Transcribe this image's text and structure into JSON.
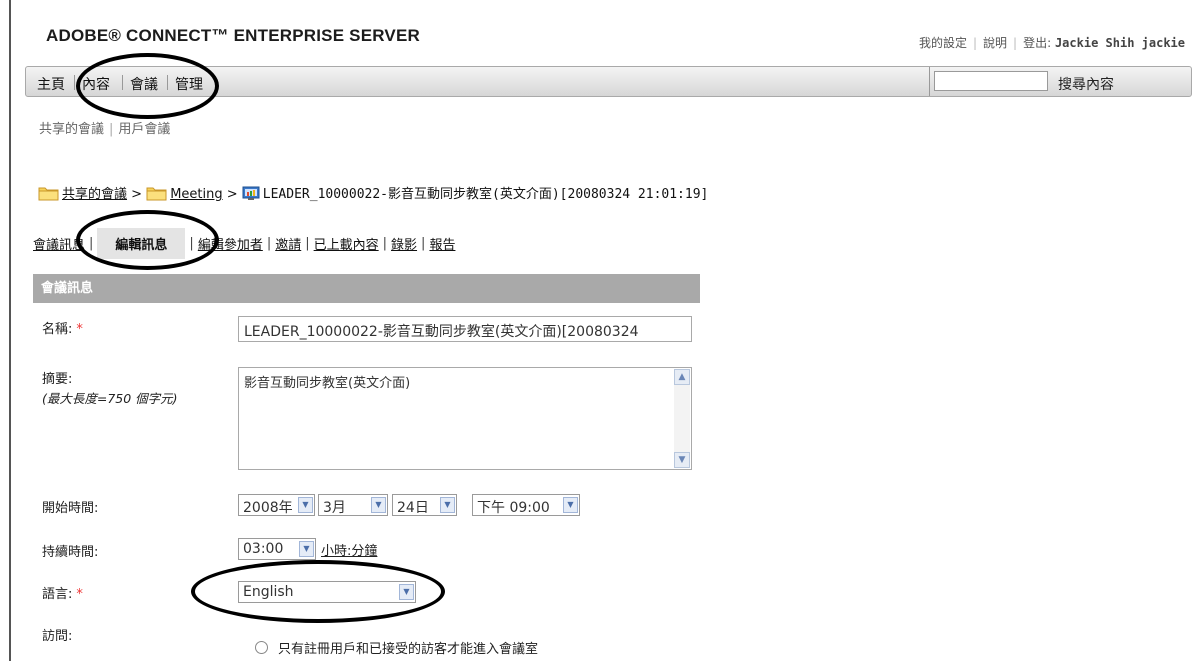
{
  "brand": "ADOBE® CONNECT™ ENTERPRISE SERVER",
  "top_links": {
    "settings": "我的設定",
    "help": "說明",
    "logout_prefix": "登出:",
    "user": "Jackie Shih jackie"
  },
  "nav": {
    "items": [
      "主頁",
      "內容",
      "會議",
      "管理"
    ],
    "search_placeholder": "",
    "search_button": "搜尋內容"
  },
  "subnav": [
    "共享的會議",
    "用戶會議"
  ],
  "breadcrumb": {
    "folder1": "共享的會議",
    "folder2": "Meeting",
    "meeting_title": "LEADER_10000022-影音互動同步教室(英文介面)[20080324 21:01:19]"
  },
  "tabs": [
    "會議訊息",
    "編輯訊息",
    "編輯參加者",
    "邀請",
    "已上載內容",
    "錄影",
    "報告"
  ],
  "section_title": "會議訊息",
  "form": {
    "name_label": "名稱:",
    "name_value": "LEADER_10000022-影音互動同步教室(英文介面)[20080324",
    "summary_label": "摘要:",
    "summary_hint": "(最大長度=750 個字元)",
    "summary_value": "影音互動同步教室(英文介面)",
    "start_label": "開始時間:",
    "start_year": "2008年",
    "start_month": "3月",
    "start_day": "24日",
    "start_time": "下午 09:00",
    "duration_label": "持續時間:",
    "duration_value": "03:00",
    "duration_unit": "小時:分鐘",
    "language_label": "語言:",
    "language_value": "English",
    "access_label": "訪問:",
    "access_option1": "只有註冊用戶和已接受的訪客才能進入會議室"
  },
  "required_mark": "*",
  "colors": {
    "section_header_bg": "#a9a9a9",
    "required": "#e33333",
    "annotation": "#000000"
  }
}
